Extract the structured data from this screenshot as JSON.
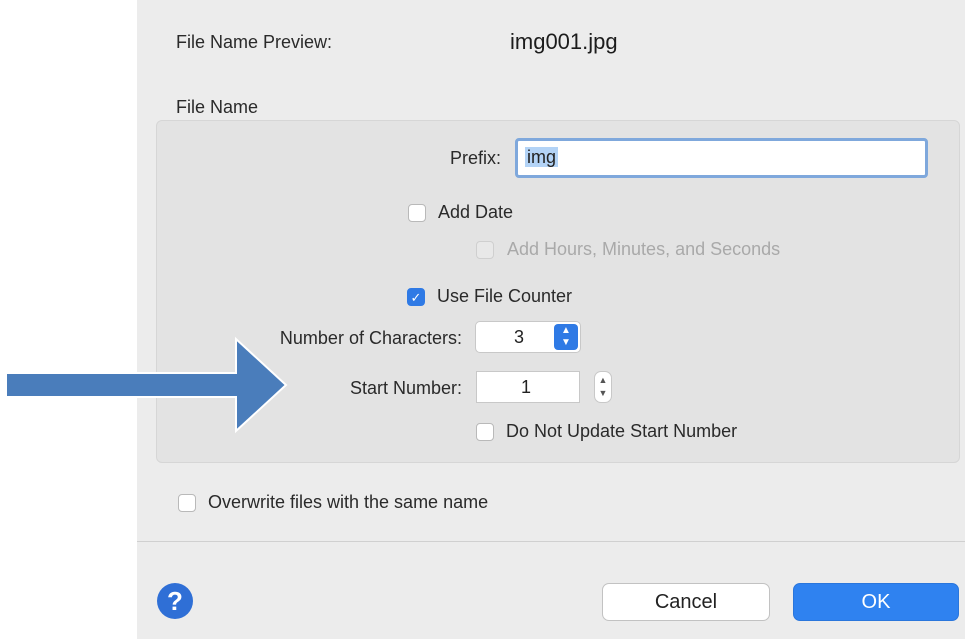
{
  "preview": {
    "label": "File Name Preview:",
    "value": "img001.jpg"
  },
  "file_name_section": {
    "title": "File Name",
    "prefix": {
      "label": "Prefix:",
      "value": "img"
    },
    "add_date": {
      "label": "Add Date",
      "checked": false
    },
    "add_hms": {
      "label": "Add Hours, Minutes, and Seconds",
      "checked": false,
      "enabled": false
    },
    "use_file_counter": {
      "label": "Use File Counter",
      "checked": true
    },
    "num_characters": {
      "label": "Number of Characters:",
      "value": "3"
    },
    "start_number": {
      "label": "Start Number:",
      "value": "1"
    },
    "do_not_update": {
      "label": "Do Not Update Start Number",
      "checked": false
    }
  },
  "overwrite": {
    "label": "Overwrite files with the same name",
    "checked": false
  },
  "buttons": {
    "cancel": "Cancel",
    "ok": "OK",
    "help": "?"
  },
  "icons": {
    "check": "✓",
    "up": "▲",
    "down": "▼"
  },
  "colors": {
    "accent": "#2f7ae5",
    "arrow": "#4a7dbb"
  }
}
